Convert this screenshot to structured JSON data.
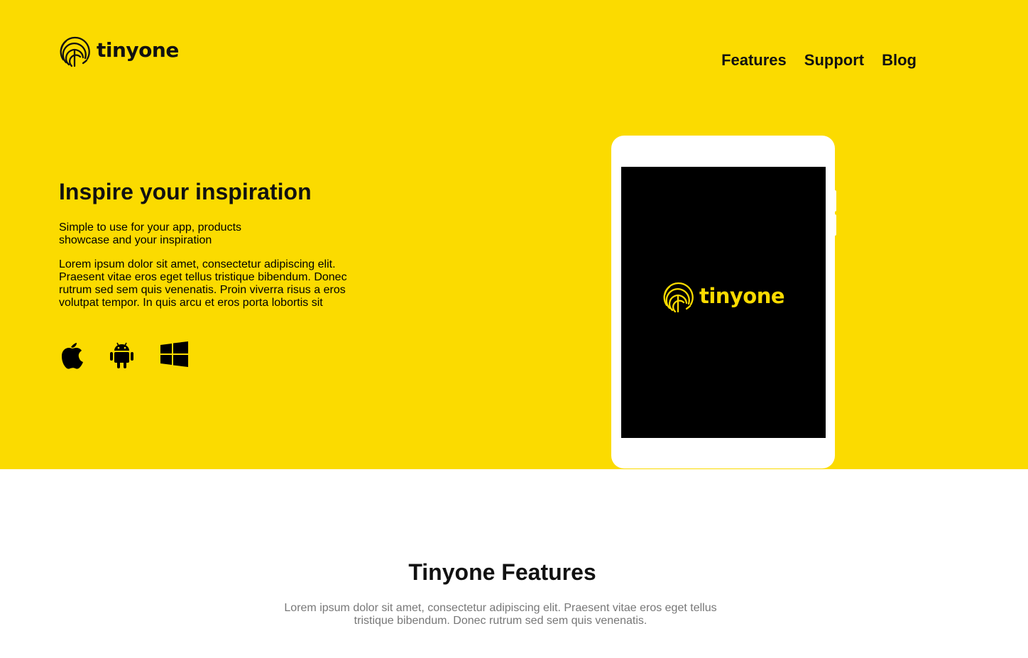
{
  "brand": {
    "name": "tinyone"
  },
  "nav": {
    "items": [
      "Features",
      "Support",
      "Blog"
    ]
  },
  "hero": {
    "headline": "Inspire your inspiration",
    "subtitle": "Simple to use for your app, products showcase and your inspiration",
    "body": "Lorem ipsum dolor sit amet, consectetur adipiscing elit. Praesent vitae eros eget tellus tristique bibendum. Donec rutrum sed sem quis venenatis. Proin viverra risus a eros volutpat tempor. In quis arcu et eros porta lobortis sit",
    "platforms": [
      "apple-icon",
      "android-icon",
      "windows-icon"
    ]
  },
  "device": {
    "screen_logo_text": "tinyone"
  },
  "features": {
    "title": "Tinyone Features",
    "description": "Lorem ipsum dolor sit amet, consectetur adipiscing elit. Praesent vitae eros eget tellus tristique bibendum. Donec rutrum sed sem quis venenatis."
  },
  "colors": {
    "brand_yellow": "#fbdb00",
    "text_dark": "#111111",
    "muted_text": "#777777",
    "screen_black": "#000000"
  }
}
